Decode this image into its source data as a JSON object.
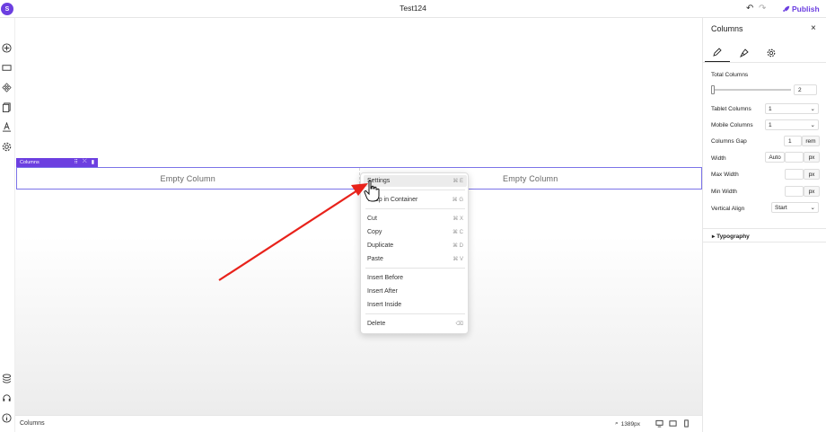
{
  "app": {
    "doc_title": "Test124",
    "logo_glyph": "S",
    "publish_label": "Publish",
    "accent": "#6c3fe0"
  },
  "left_rail": {
    "top_icons": [
      "add-icon",
      "layout-icon",
      "components-icon",
      "pages-icon",
      "typography-icon",
      "settings-gear-icon"
    ],
    "bottom_icons": [
      "layers-icon",
      "support-icon",
      "info-icon"
    ]
  },
  "canvas": {
    "columns_tag": "Columns",
    "columns": [
      {
        "label": "Empty Column"
      },
      {
        "label": "Empty Column"
      }
    ]
  },
  "context_menu": {
    "items": [
      {
        "label": "Settings",
        "shortcut": "⌘ E",
        "highlighted": true
      },
      {
        "label": "Wrap in Container",
        "shortcut": "⌘ G"
      },
      {
        "label": "Cut",
        "shortcut": "⌘ X"
      },
      {
        "label": "Copy",
        "shortcut": "⌘ C"
      },
      {
        "label": "Duplicate",
        "shortcut": "⌘ D"
      },
      {
        "label": "Paste",
        "shortcut": "⌘ V"
      },
      {
        "label": "Insert Before",
        "shortcut": ""
      },
      {
        "label": "Insert After",
        "shortcut": ""
      },
      {
        "label": "Insert Inside",
        "shortcut": ""
      },
      {
        "label": "Delete",
        "shortcut": "⌫"
      }
    ]
  },
  "statusbar": {
    "label": "Columns",
    "width_readout": "1389px"
  },
  "panel": {
    "title": "Columns",
    "close": "×",
    "tabs": [
      "edit-icon",
      "style-brush-icon",
      "settings-gear-icon"
    ],
    "total_columns_label": "Total Columns",
    "total_columns_value": "2",
    "tablet_columns_label": "Tablet Columns",
    "tablet_columns_value": "1",
    "mobile_columns_label": "Mobile Columns",
    "mobile_columns_value": "1",
    "columns_gap_label": "Columns Gap",
    "columns_gap_value": "1",
    "columns_gap_unit": "rem",
    "width_label": "Width",
    "width_value": "Auto",
    "width_unit": "px",
    "max_width_label": "Max Width",
    "max_width_unit": "px",
    "min_width_label": "Min Width",
    "min_width_unit": "px",
    "vertical_align_label": "Vertical Align",
    "vertical_align_value": "Start",
    "typography_label": "Typography"
  }
}
